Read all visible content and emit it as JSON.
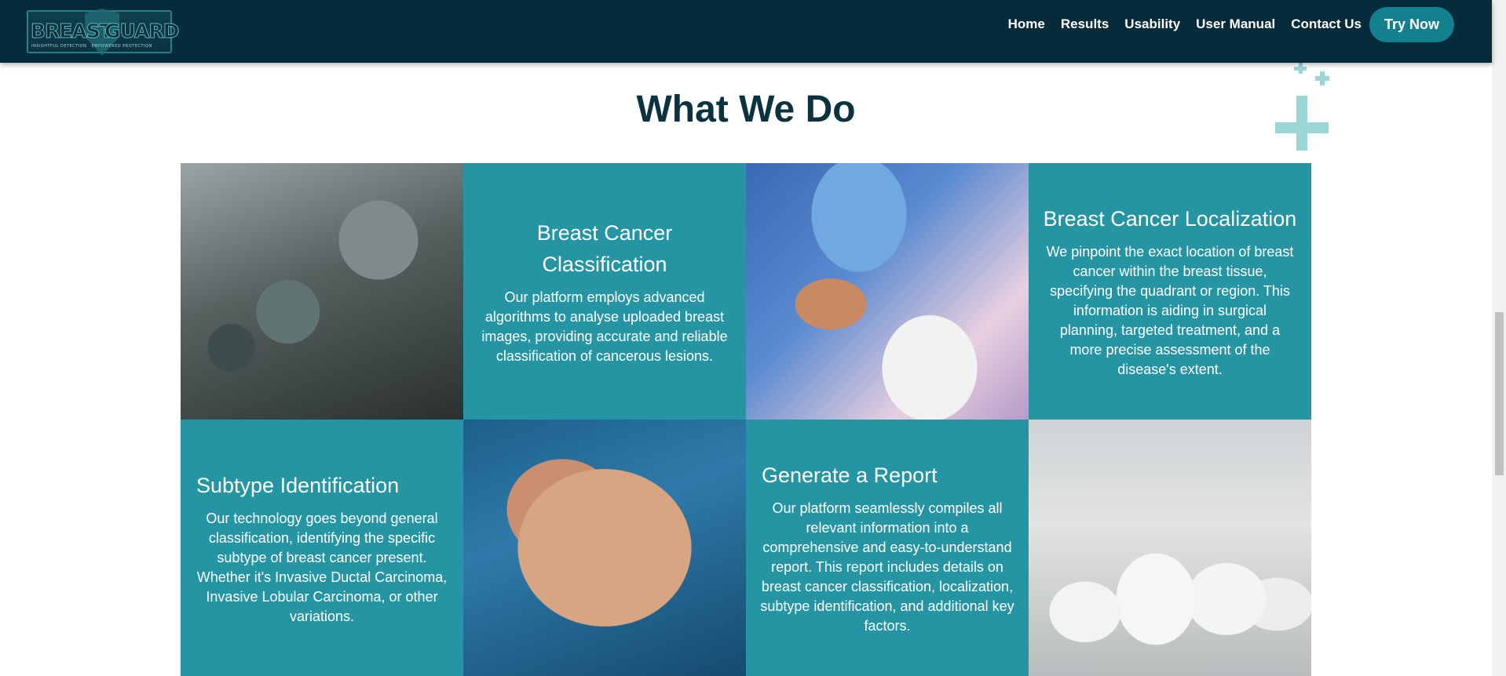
{
  "header": {
    "logo_word_1": "BREAST",
    "logo_word_2": "GUARD",
    "logo_tagline": "INSIGHTFUL DETECTION · EMPOWERED PROTECTION"
  },
  "nav": {
    "items": [
      {
        "label": "Home"
      },
      {
        "label": "Results"
      },
      {
        "label": "Usability"
      },
      {
        "label": "User Manual"
      },
      {
        "label": "Contact Us"
      }
    ],
    "cta_label": "Try Now"
  },
  "section": {
    "title": "What We Do"
  },
  "cards": [
    {
      "title": "Breast Cancer Classification",
      "body": "Our platform employs advanced algorithms to analyse uploaded breast images, providing accurate and reliable classification of cancerous lesions."
    },
    {
      "title": "Breast Cancer Localization",
      "body": "We pinpoint the exact location of breast cancer within the breast tissue, specifying the quadrant or region. This information is aiding in surgical planning, targeted treatment, and a more precise assessment of the disease's extent."
    },
    {
      "title": "Subtype Identification",
      "body": "Our technology goes beyond general classification, identifying the specific subtype of breast cancer present. Whether it's Invasive Ductal Carcinoma, Invasive Lobular Carcinoma, or other variations."
    },
    {
      "title": "Generate a Report",
      "body": "Our platform seamlessly compiles all relevant information into a comprehensive and easy-to-understand report. This report includes details on breast cancer classification, localization, subtype identification, and additional key factors."
    }
  ],
  "images": {
    "operating_room": "operating-room-photo",
    "surgeon": "surgeon-photo",
    "holding_hands": "holding-hands-photo",
    "medical_team": "medical-team-photo"
  },
  "colors": {
    "header_bg": "#062c3c",
    "accent_teal": "#2594a3",
    "button_teal": "#13808f",
    "title_color": "#0a3340",
    "plus_decor": "#9cd6d4"
  }
}
